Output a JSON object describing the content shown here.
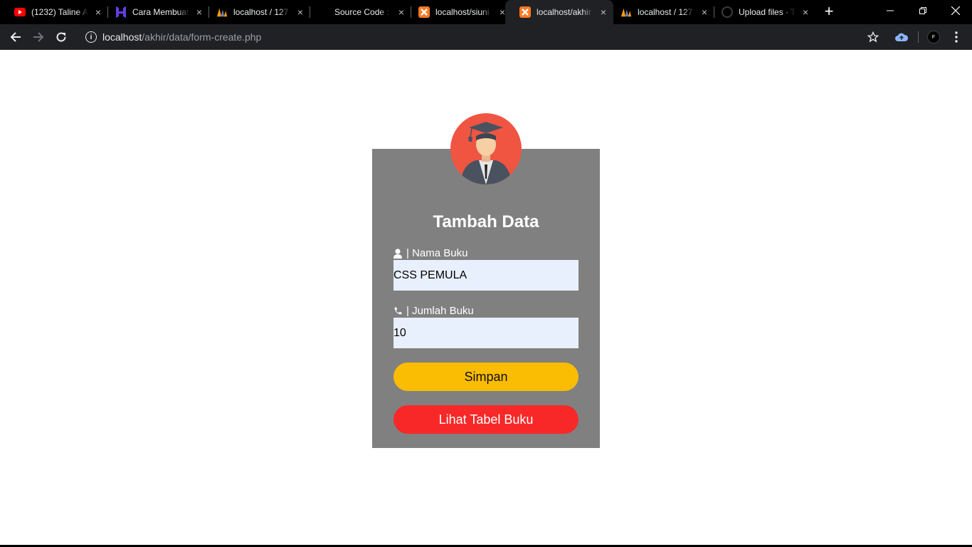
{
  "browser": {
    "tabs": [
      {
        "title": "(1232) Taline A",
        "favicon": "youtube-icon"
      },
      {
        "title": "Cara Membuat",
        "favicon": "hostinger-icon"
      },
      {
        "title": "localhost / 127",
        "favicon": "phpmyadmin-icon"
      },
      {
        "title": "Source Code :",
        "favicon": ""
      },
      {
        "title": "localhost/siuni",
        "favicon": "xampp-icon"
      },
      {
        "title": "localhost/akhir",
        "favicon": "xampp-icon",
        "active": true
      },
      {
        "title": "localhost / 127",
        "favicon": "phpmyadmin-icon"
      },
      {
        "title": "Upload files · T",
        "favicon": "github-icon"
      }
    ],
    "close_glyph": "×",
    "new_tab_glyph": "+",
    "address": {
      "host": "localhost",
      "path": "/akhir/data/form-create.php"
    },
    "profile_initial": "F"
  },
  "form": {
    "title": "Tambah Data",
    "name_label": "| Nama Buku",
    "name_value": "CSS PEMULA",
    "qty_label": "| Jumlah Buku",
    "qty_value": "10",
    "save_label": "Simpan",
    "view_label": "Lihat Tabel Buku"
  },
  "colors": {
    "card_bg": "#808080",
    "avatar_bg": "#f05542",
    "save_button": "#fbbc04",
    "view_button": "#f92828",
    "input_bg": "#e8f0fe"
  }
}
